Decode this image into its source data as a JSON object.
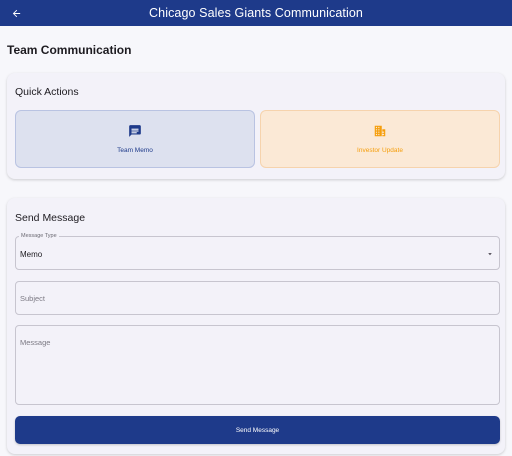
{
  "app_bar": {
    "title": "Chicago Sales Giants Communication",
    "back_icon": "arrow-left-icon"
  },
  "page": {
    "title": "Team Communication"
  },
  "quick_actions": {
    "title": "Quick Actions",
    "items": [
      {
        "label": "Team Memo",
        "icon": "memo-icon",
        "color": "#1e3a8a"
      },
      {
        "label": "Investor Update",
        "icon": "building-icon",
        "color": "#f59e0b"
      }
    ]
  },
  "send_message": {
    "title": "Send Message",
    "message_type": {
      "label": "Message Type",
      "value": "Memo",
      "icon": "dropdown-arrow-icon"
    },
    "subject": {
      "placeholder": "Subject",
      "value": ""
    },
    "message": {
      "placeholder": "Message",
      "value": ""
    },
    "submit_label": "Send Message"
  },
  "colors": {
    "primary": "#1e3a8a",
    "accent": "#f59e0b",
    "background": "#f7f7fb"
  }
}
